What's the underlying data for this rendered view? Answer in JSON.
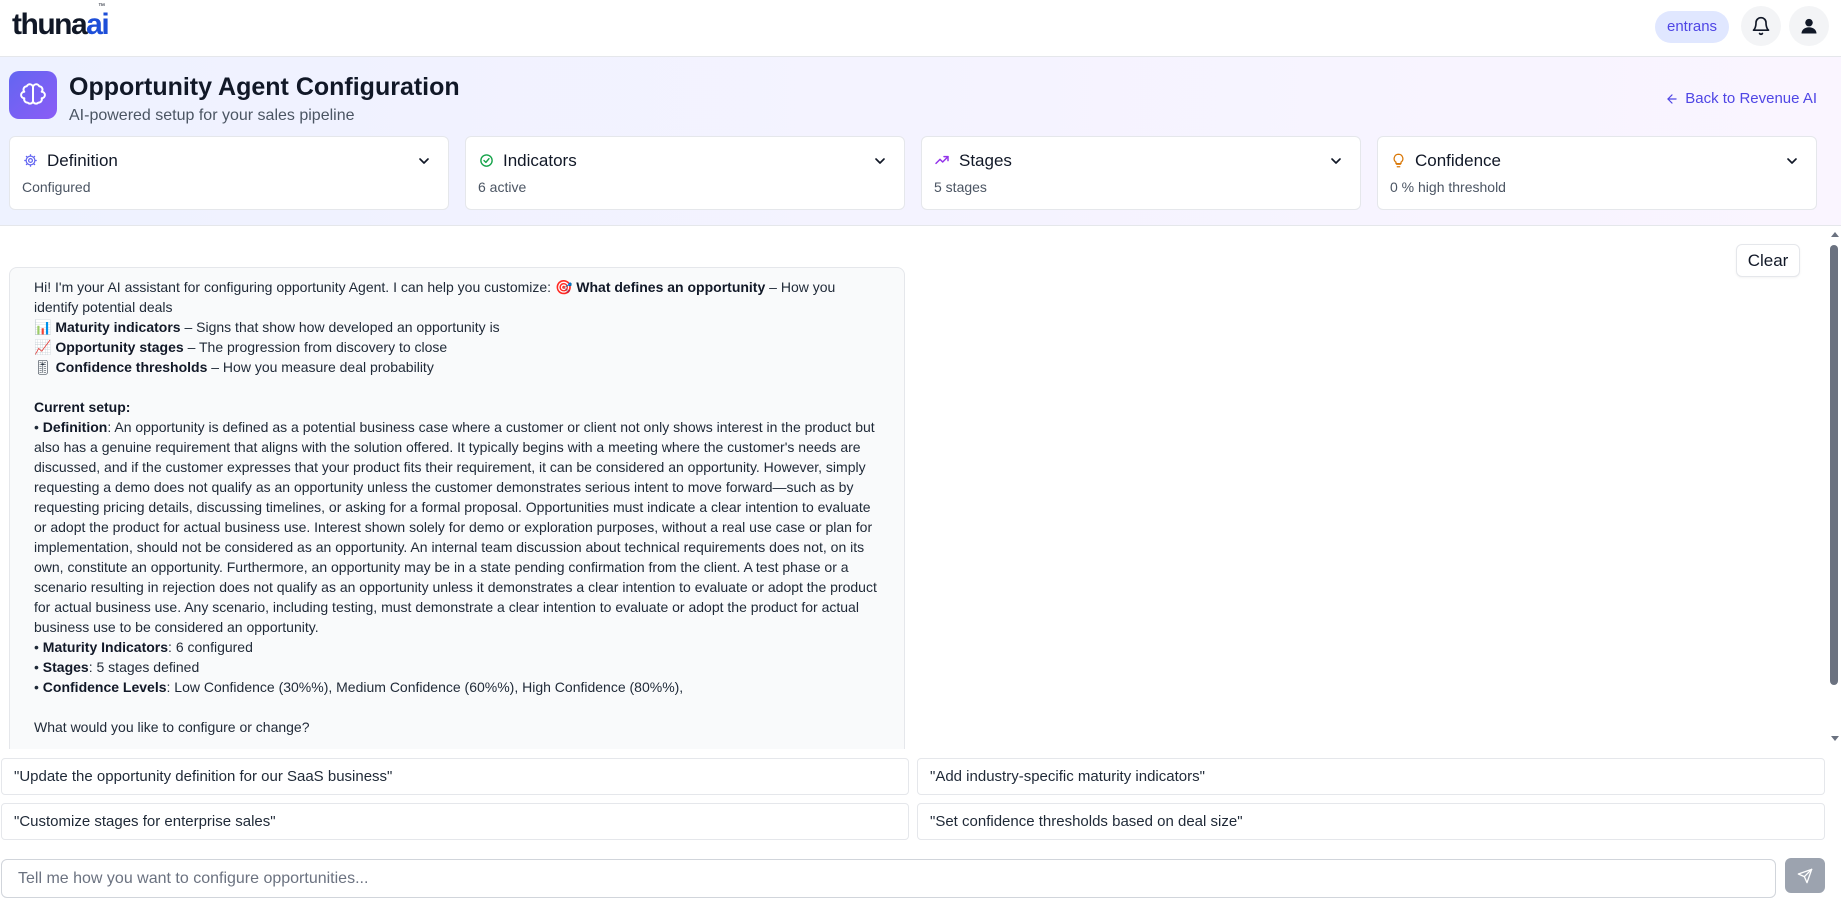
{
  "nav": {
    "logo_text": "thuna",
    "logo_accent": "ai",
    "logo_tm": "™",
    "org_name": "entrans",
    "bell_icon": "bell-icon",
    "user_icon": "user-icon"
  },
  "header": {
    "icon": "brain-icon",
    "title": "Opportunity Agent Configuration",
    "subtitle": "AI-powered setup for your sales pipeline",
    "back_label": "Back to Revenue AI"
  },
  "cards": [
    {
      "title": "Definition",
      "subtitle": "Configured",
      "icon": "gear-icon",
      "icon_color": "#6366f1"
    },
    {
      "title": "Indicators",
      "subtitle": "6 active",
      "icon": "check-circle-icon",
      "icon_color": "#16a34a"
    },
    {
      "title": "Stages",
      "subtitle": "5 stages",
      "icon": "trending-up-icon",
      "icon_color": "#9333ea"
    },
    {
      "title": "Confidence",
      "subtitle": "0 % high threshold",
      "icon": "lightbulb-icon",
      "icon_color": "#d97706"
    }
  ],
  "chat": {
    "clear_label": "Clear",
    "message": {
      "intro": "Hi! I'm your AI assistant for configuring opportunity Agent. I can help you customize: 🎯 ",
      "intro_bold": "What defines an opportunity",
      "intro_tail": " – How you identify potential deals",
      "line1_icon": "📊",
      "line1_bold": "Maturity indicators",
      "line1_tail": " – Signs that show how developed an opportunity is",
      "line2_icon": "📈",
      "line2_bold": "Opportunity stages",
      "line2_tail": " – The progression from discovery to close",
      "line3_icon": "🎚",
      "line3_bold": "Confidence thresholds",
      "line3_tail": " – How you measure deal probability",
      "setup_heading": "Current setup:",
      "def_label": "Definition",
      "def_text": ": An opportunity is defined as a potential business case where a customer or client not only shows interest in the product but also has a genuine requirement that aligns with the solution offered. It typically begins with a meeting where the customer's needs are discussed, and if the customer expresses that your product fits their requirement, it can be considered an opportunity. However, simply requesting a demo does not qualify as an opportunity unless the customer demonstrates serious intent to move forward—such as by requesting pricing details, discussing timelines, or asking for a formal proposal. Opportunities must indicate a clear intention to evaluate or adopt the product for actual business use. Interest shown solely for demo or exploration purposes, without a real use case or plan for implementation, should not be considered as an opportunity. An internal team discussion about technical requirements does not, on its own, constitute an opportunity. Furthermore, an opportunity may be in a state pending confirmation from the client. A test phase or a scenario resulting in rejection does not qualify as an opportunity unless it demonstrates a clear intention to evaluate or adopt the product for actual business use. Any scenario, including testing, must demonstrate a clear intention to evaluate or adopt the product for actual business use to be considered an opportunity.",
      "mat_label": "Maturity Indicators",
      "mat_text": ": 6 configured",
      "stages_label": "Stages",
      "stages_text": ": 5 stages defined",
      "conf_label": "Confidence Levels",
      "conf_text": ": Low Confidence (30%%), Medium Confidence (60%%), High Confidence (80%%),",
      "closing": "What would you like to configure or change?"
    }
  },
  "suggestions": [
    "\"Update the opportunity definition for our SaaS business\"",
    "\"Add industry-specific maturity indicators\"",
    "\"Customize stages for enterprise sales\"",
    "\"Set confidence thresholds based on deal size\""
  ],
  "input": {
    "placeholder": "Tell me how you want to configure opportunities...",
    "value": "",
    "send_icon": "send-icon"
  }
}
